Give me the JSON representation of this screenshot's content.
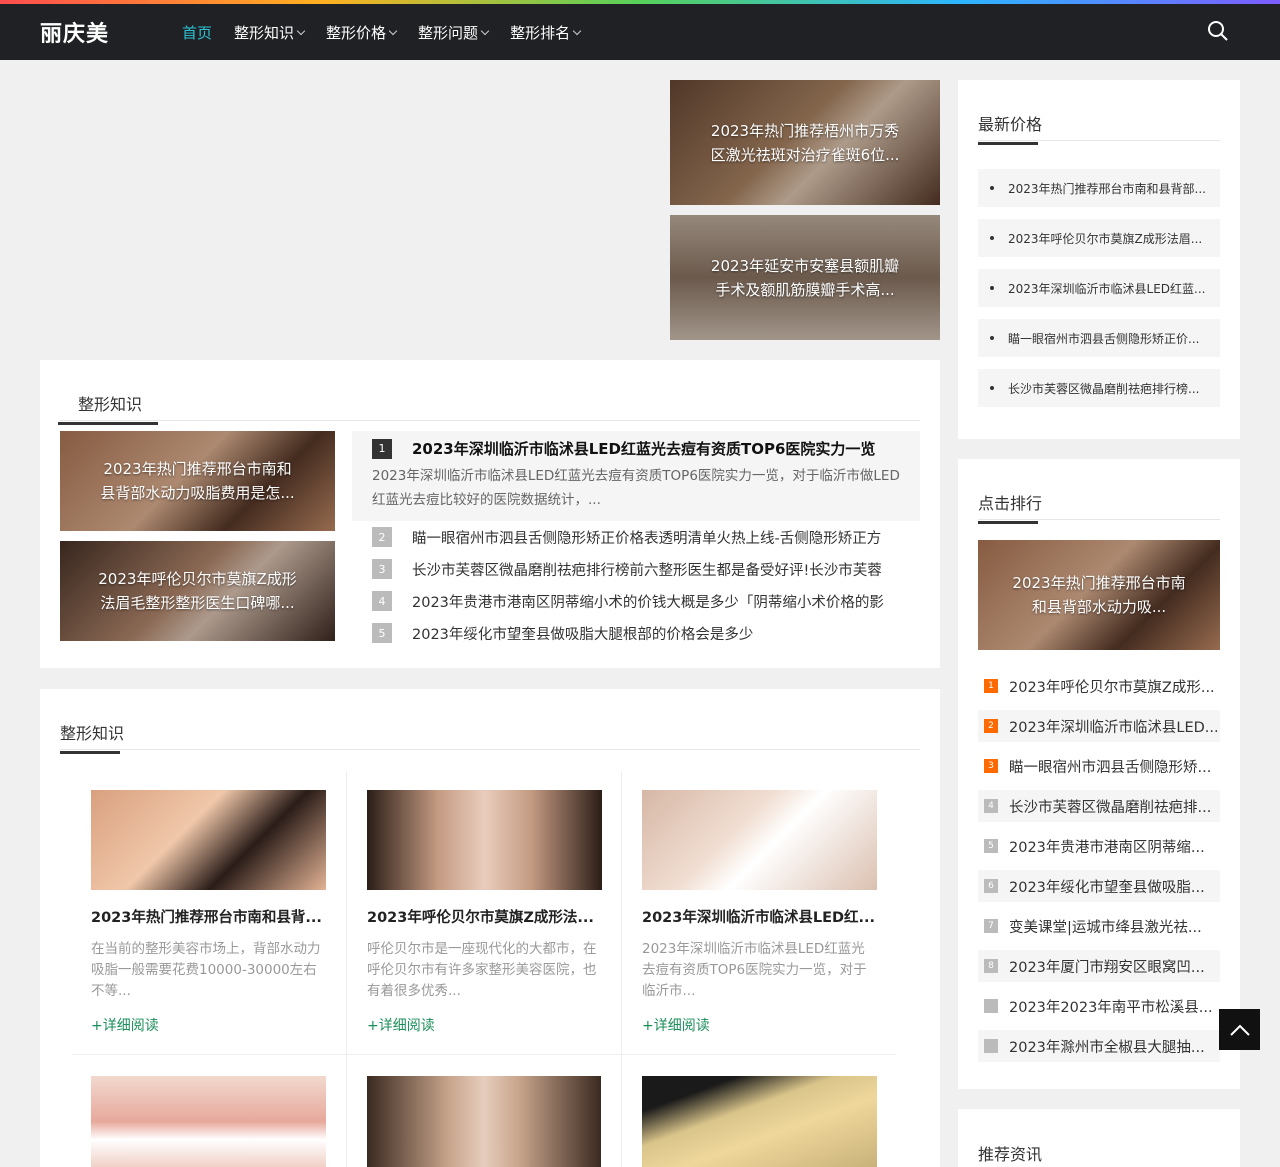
{
  "nav": {
    "logo": "丽庆美",
    "items": [
      {
        "label": "首页",
        "active": true
      },
      {
        "label": "整形知识",
        "dropdown": true
      },
      {
        "label": "整形价格",
        "dropdown": true
      },
      {
        "label": "整形问题",
        "dropdown": true
      },
      {
        "label": "整形排名",
        "dropdown": true
      }
    ],
    "search_icon": "search-icon"
  },
  "featured": [
    {
      "title": "2023年热门推荐梧州市万秀区激光祛斑对治疗雀斑6位..."
    },
    {
      "title": "2023年延安市安塞县额肌瓣手术及额肌筋膜瓣手术高..."
    }
  ],
  "knowledge1": {
    "title": "整形知识",
    "image_cards": [
      {
        "title": "2023年热门推荐邢台市南和县背部水动力吸脂费用是怎..."
      },
      {
        "title": "2023年呼伦贝尔市莫旗Z成形法眉毛整形整形医生口碑哪..."
      }
    ],
    "top_item": {
      "num": "1",
      "title": "2023年深圳临沂市临沭县LED红蓝光去痘有资质TOP6医院实力一览",
      "desc": "2023年深圳临沂市临沭县LED红蓝光去痘有资质TOP6医院实力一览，对于临沂市做LED红蓝光去痘比较好的医院数据统计，..."
    },
    "items": [
      {
        "num": "2",
        "title": "瞄一眼宿州市泗县舌侧隐形矫正价格表透明清单火热上线-舌侧隐形矫正方"
      },
      {
        "num": "3",
        "title": "长沙市芙蓉区微晶磨削祛疤排行榜前六整形医生都是备受好评!长沙市芙蓉"
      },
      {
        "num": "4",
        "title": "2023年贵港市港南区阴蒂缩小术的价钱大概是多少「阴蒂缩小术价格的影"
      },
      {
        "num": "5",
        "title": "2023年绥化市望奎县做吸脂大腿根部的价格会是多少"
      }
    ]
  },
  "knowledge2": {
    "title": "整形知识",
    "cards": [
      {
        "title": "2023年热门推荐邢台市南和县背...",
        "desc": "在当前的整形美容市场上，背部水动力吸脂一般需要花费10000-30000左右不等...",
        "more": "+详细阅读"
      },
      {
        "title": "2023年呼伦贝尔市莫旗Z成形法...",
        "desc": "呼伦贝尔市是一座现代化的大都市，在呼伦贝尔市有许多家整形美容医院，也有着很多优秀...",
        "more": "+详细阅读"
      },
      {
        "title": "2023年深圳临沂市临沭县LED红...",
        "desc": "2023年深圳临沂市临沭县LED红蓝光去痘有资质TOP6医院实力一览，对于临沂市...",
        "more": "+详细阅读"
      }
    ]
  },
  "sidebar": {
    "latest_price": {
      "title": "最新价格",
      "items": [
        "2023年热门推荐邢台市南和县背部...",
        "2023年呼伦贝尔市莫旗Z成形法眉...",
        "2023年深圳临沂市临沭县LED红蓝...",
        "瞄一眼宿州市泗县舌侧隐形矫正价...",
        "长沙市芙蓉区微晶磨削祛疤排行榜..."
      ]
    },
    "hot_rank": {
      "title": "点击排行",
      "image_title": "2023年热门推荐邢台市南和县背部水动力吸...",
      "items": [
        {
          "num": "1",
          "title": "2023年呼伦贝尔市莫旗Z成形..."
        },
        {
          "num": "2",
          "title": "2023年深圳临沂市临沭县LED..."
        },
        {
          "num": "3",
          "title": "瞄一眼宿州市泗县舌侧隐形矫..."
        },
        {
          "num": "4",
          "title": "长沙市芙蓉区微晶磨削祛疤排..."
        },
        {
          "num": "5",
          "title": "2023年贵港市港南区阴蒂缩..."
        },
        {
          "num": "6",
          "title": "2023年绥化市望奎县做吸脂..."
        },
        {
          "num": "7",
          "title": "变美课堂|运城市绛县激光祛..."
        },
        {
          "num": "8",
          "title": "2023年厦门市翔安区眼窝凹..."
        },
        {
          "num": "",
          "title": "2023年2023年南平市松溪县..."
        },
        {
          "num": "",
          "title": "2023年滁州市全椒县大腿抽..."
        }
      ]
    },
    "recommend": {
      "title": "推荐资讯"
    }
  },
  "colors": {
    "nav_bg": "#1f2124",
    "active": "#2ec4d6",
    "rank_orange": "#ff6a00",
    "more_link": "#1a8f5a"
  }
}
